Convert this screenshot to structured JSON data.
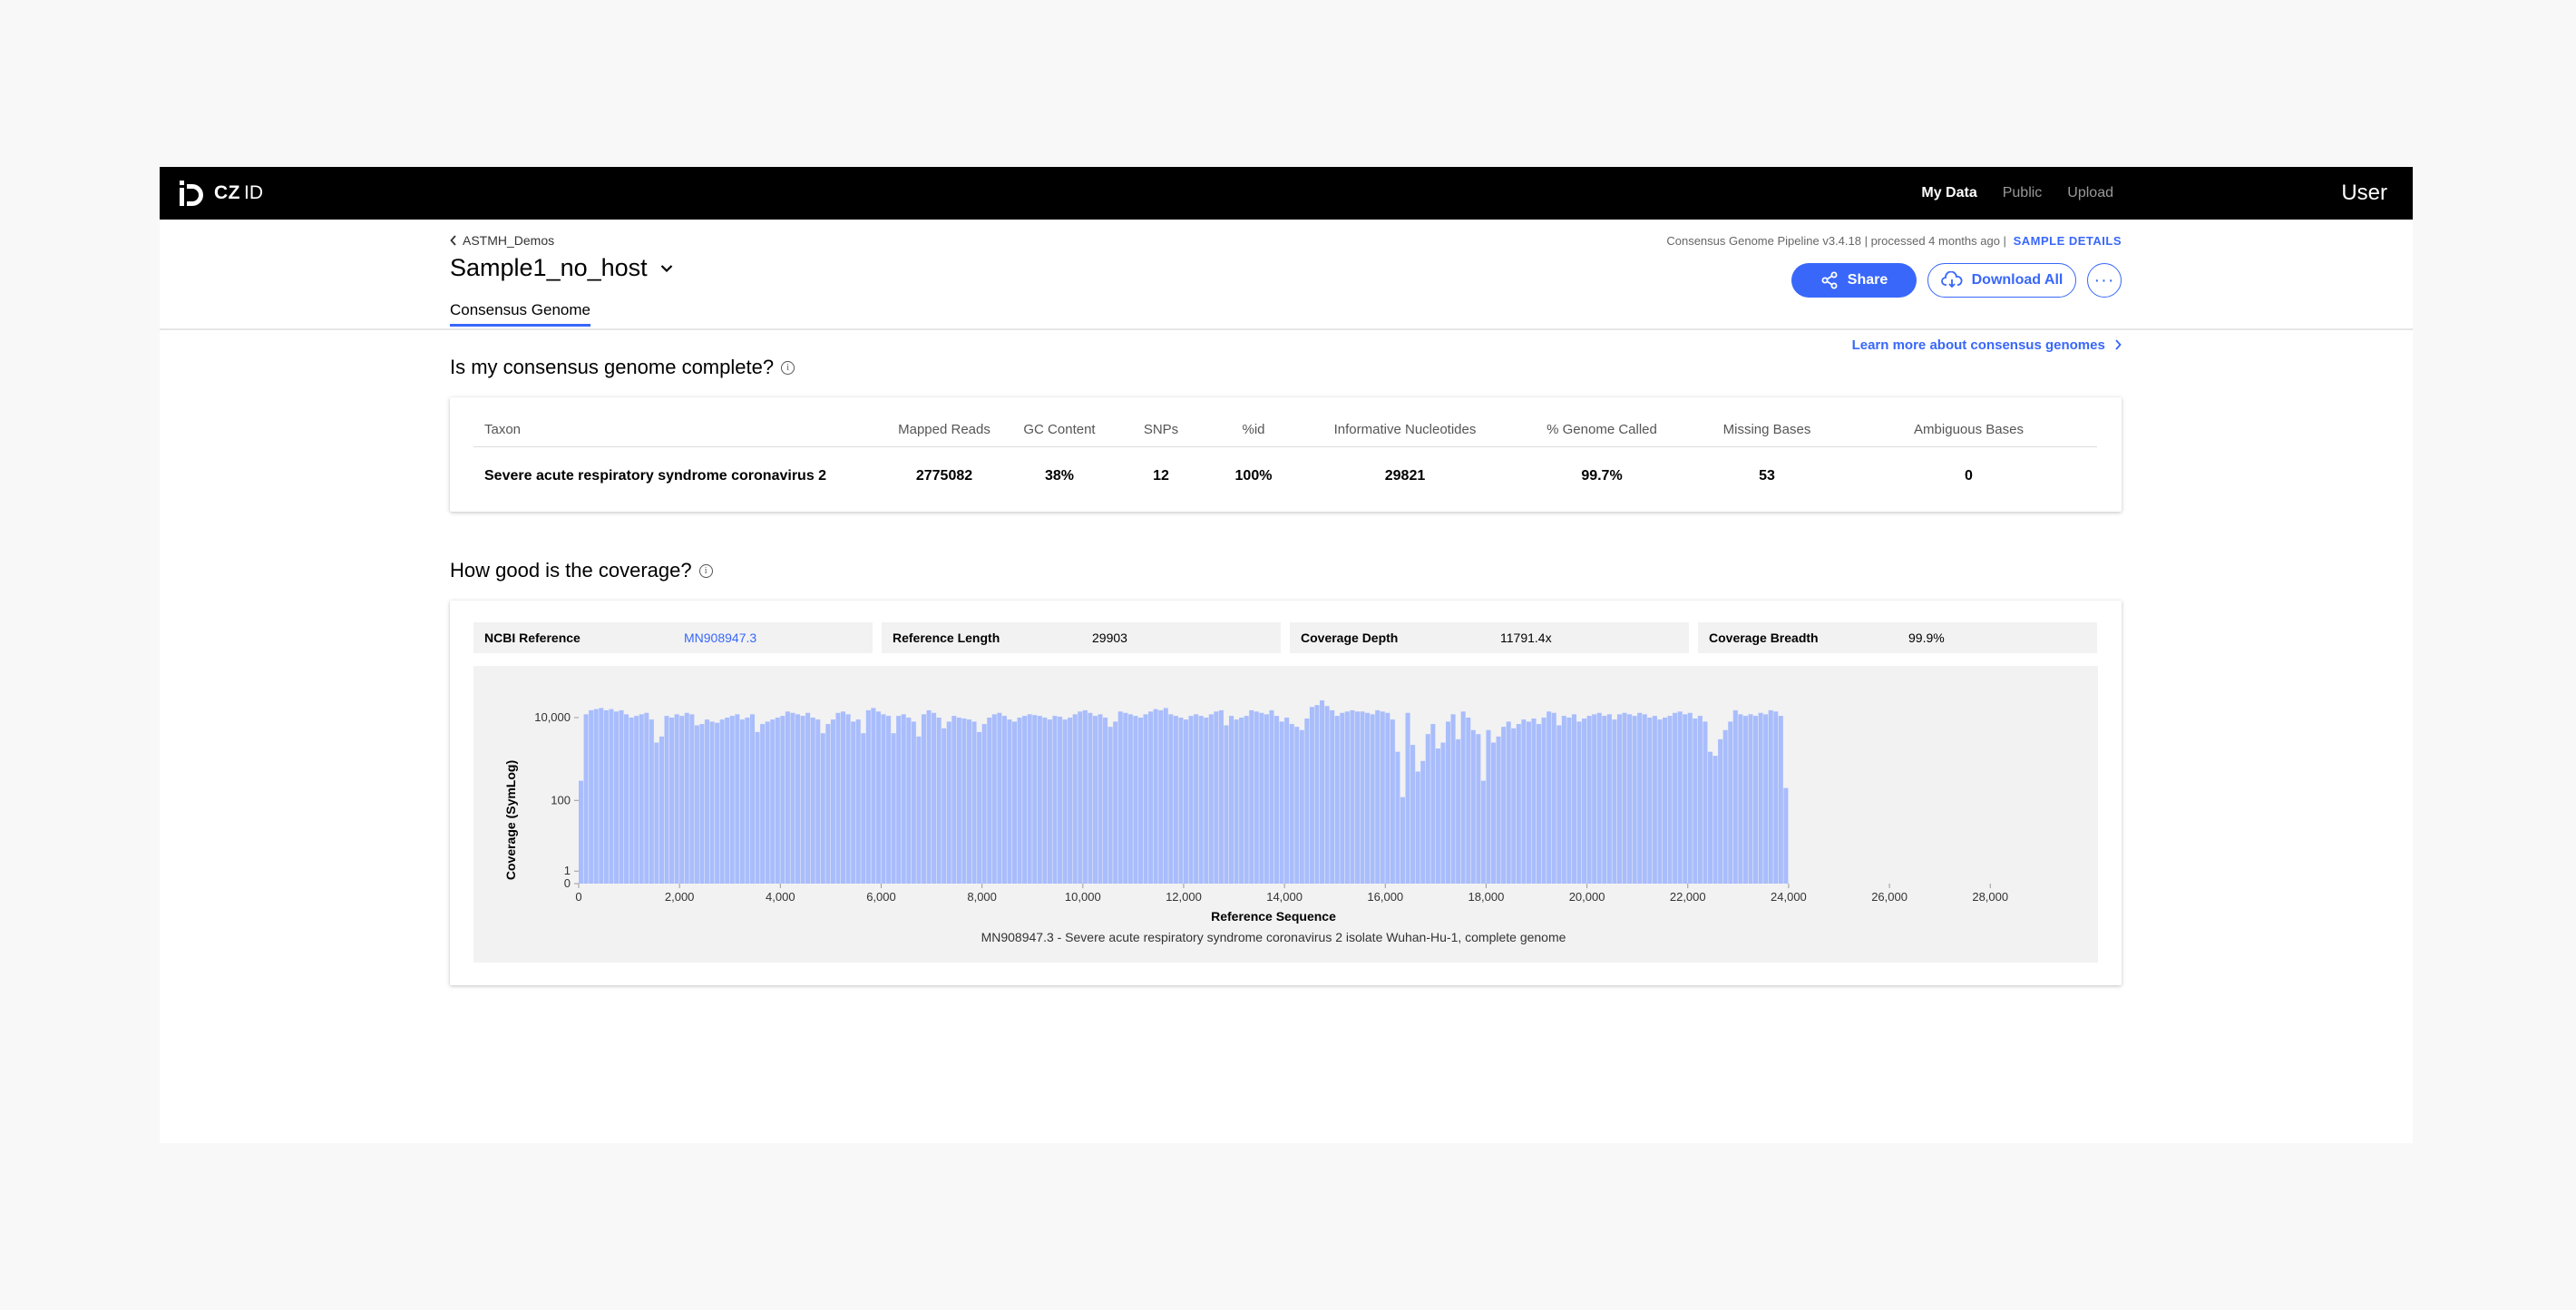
{
  "nav": {
    "logo_text": "CZ",
    "logo_suffix": "ID",
    "links": [
      "My Data",
      "Public",
      "Upload"
    ],
    "user": "User"
  },
  "header": {
    "breadcrumb": "ASTMH_Demos",
    "sample_name": "Sample1_no_host",
    "tab": "Consensus Genome",
    "pipeline_info": "Consensus Genome Pipeline v3.4.18 | processed 4 months ago |",
    "sample_details": "SAMPLE DETAILS",
    "share": "Share",
    "download_all": "Download All",
    "learn_more": "Learn more about consensus genomes"
  },
  "section1": {
    "heading": "Is my consensus genome complete?",
    "columns": [
      "Taxon",
      "Mapped Reads",
      "GC Content",
      "SNPs",
      "%id",
      "Informative Nucleotides",
      "% Genome Called",
      "Missing Bases",
      "Ambiguous Bases"
    ],
    "row": [
      "Severe acute respiratory syndrome coronavirus 2",
      "2775082",
      "38%",
      "12",
      "100%",
      "29821",
      "99.7%",
      "53",
      "0"
    ]
  },
  "section2": {
    "heading": "How good is the coverage?",
    "info": [
      {
        "label": "NCBI Reference",
        "value": "MN908947.3"
      },
      {
        "label": "Reference Length",
        "value": "29903"
      },
      {
        "label": "Coverage Depth",
        "value": "11791.4x"
      },
      {
        "label": "Coverage Breadth",
        "value": "99.9%"
      }
    ]
  },
  "chart_data": {
    "type": "bar",
    "title": "",
    "xlabel": "Reference Sequence",
    "ylabel": "Coverage (SymLog)",
    "caption": "MN908947.3 - Severe acute respiratory syndrome coronavirus 2 isolate Wuhan-Hu-1, complete genome",
    "yscale": "symlog",
    "xlim": [
      0,
      29903
    ],
    "x_ticks": [
      0,
      2000,
      4000,
      6000,
      8000,
      10000,
      12000,
      14000,
      16000,
      18000,
      20000,
      22000,
      24000,
      26000,
      28000
    ],
    "x_tick_labels": [
      "0",
      "2,000",
      "4,000",
      "6,000",
      "8,000",
      "10,000",
      "12,000",
      "14,000",
      "16,000",
      "18,000",
      "20,000",
      "22,000",
      "24,000",
      "26,000",
      "28,000"
    ],
    "y_ticks": [
      0,
      1,
      100,
      10000
    ],
    "y_tick_labels": [
      "0",
      "1",
      "100",
      "10,000"
    ],
    "bin_width": 100,
    "values": [
      300,
      12000,
      15000,
      16000,
      17000,
      15000,
      16000,
      14000,
      15000,
      12000,
      10000,
      11000,
      12000,
      13000,
      9000,
      2500,
      3500,
      11000,
      10000,
      12000,
      11000,
      13000,
      12000,
      6500,
      7000,
      9000,
      8000,
      7500,
      9000,
      10000,
      11000,
      12000,
      9000,
      10000,
      12000,
      4500,
      7000,
      8000,
      9000,
      10000,
      11000,
      14000,
      13000,
      12000,
      11000,
      13000,
      10000,
      9000,
      4200,
      7000,
      9000,
      13000,
      14000,
      12000,
      8000,
      9000,
      4200,
      15000,
      17000,
      14000,
      12000,
      11000,
      4200,
      11000,
      12000,
      10000,
      8000,
      3500,
      12000,
      15000,
      13000,
      10000,
      5500,
      8000,
      11000,
      10000,
      9500,
      9000,
      8000,
      4500,
      7000,
      10000,
      12000,
      13000,
      11000,
      9000,
      8000,
      10000,
      11000,
      12000,
      11500,
      11000,
      10000,
      9000,
      11000,
      10500,
      9000,
      10000,
      12000,
      14000,
      15000,
      13000,
      11000,
      12000,
      10000,
      6000,
      8000,
      14000,
      13000,
      12000,
      11000,
      10000,
      12000,
      14000,
      16000,
      15000,
      17000,
      12000,
      11000,
      10000,
      9000,
      11000,
      12000,
      11000,
      10000,
      12000,
      14000,
      15000,
      6500,
      11000,
      9000,
      10000,
      11000,
      15000,
      14000,
      13000,
      12000,
      15000,
      11000,
      8000,
      10000,
      7000,
      6000,
      5000,
      9500,
      18000,
      20000,
      26000,
      19000,
      15000,
      11000,
      13000,
      14000,
      15000,
      14000,
      14000,
      13000,
      12000,
      15000,
      14000,
      13000,
      9000,
      1500,
      120,
      13000,
      2200,
      500,
      900,
      4000,
      7000,
      1800,
      2500,
      8000,
      12000,
      3000,
      14000,
      10000,
      5000,
      4000,
      300,
      5000,
      2500,
      3500,
      6000,
      8000,
      5500,
      7000,
      9000,
      8000,
      9500,
      7000,
      10000,
      14000,
      13000,
      6500,
      11000,
      10000,
      12000,
      8000,
      9500,
      11000,
      12000,
      13000,
      11000,
      12000,
      9000,
      12000,
      13000,
      12000,
      11000,
      13000,
      12000,
      10000,
      11000,
      9000,
      10000,
      11000,
      13000,
      14000,
      12000,
      13000,
      9500,
      11000,
      8000,
      1500,
      1200,
      3000,
      5000,
      8000,
      15000,
      12000,
      11000,
      12000,
      11000,
      13000,
      12000,
      15000,
      14000,
      11000,
      200
    ]
  }
}
